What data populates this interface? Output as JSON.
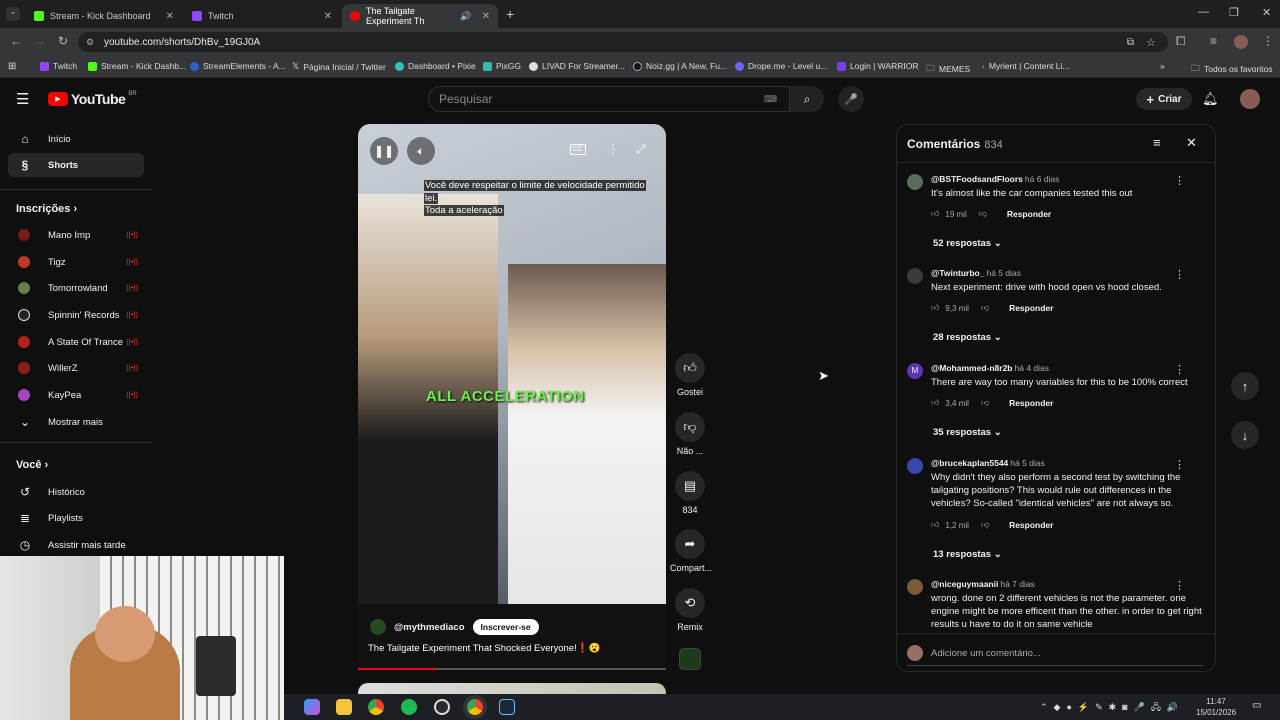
{
  "browser": {
    "tabs": [
      {
        "label": "Stream - Kick Dashboard",
        "color": "#53fc18"
      },
      {
        "label": "Twitch",
        "color": "#9146ff"
      },
      {
        "label": "The Tailgate Experiment Th",
        "color": "#ff0000"
      }
    ],
    "url": "youtube.com/shorts/DhBv_19GJ0A",
    "bookmarks": [
      "Twitch",
      "Stream - Kick Dashb...",
      "StreamElements - A...",
      "Página Inicial / Twitter",
      "Dashboard • Pixie",
      "PixGG",
      "LIVAD For Streamer...",
      "Noiz.gg | A New, Fu...",
      "Drope.me - Level u...",
      "Login | WARRIOR",
      "MEMES",
      "Myrient | Content Li..."
    ],
    "favorites_label": "Todos os favoritos"
  },
  "youtube": {
    "logo": "YouTube",
    "country": "BR",
    "search_placeholder": "Pesquisar",
    "create_label": "Criar"
  },
  "sidebar": {
    "main": [
      {
        "label": "Início",
        "icon": "home-icon"
      },
      {
        "label": "Shorts",
        "icon": "shorts-icon"
      }
    ],
    "subs_heading": "Inscrições",
    "subs": [
      {
        "label": "Mano Imp",
        "color": "#7a1b1b"
      },
      {
        "label": "Tigz",
        "color": "#c0392b"
      },
      {
        "label": "Tomorrowland",
        "color": "#6a7d4c"
      },
      {
        "label": "Spinnin' Records",
        "color": "#222222"
      },
      {
        "label": "A State Of Trance",
        "color": "#b22222"
      },
      {
        "label": "WillerZ",
        "color": "#8b1c1c"
      },
      {
        "label": "KayPea",
        "color": "#a346c2"
      }
    ],
    "show_more": "Mostrar mais",
    "you_heading": "Você",
    "you_items": [
      "Histórico",
      "Playlists",
      "Assistir mais tarde"
    ]
  },
  "video": {
    "caption_line1": "Você deve respeitar o limite de velocidade permitido",
    "caption_line2": "lei.",
    "caption_line3": "Toda a aceleração",
    "overlay_text": "ALL ACCELERATION",
    "channel": "@mythmediaco",
    "subscribe": "Inscrever-se",
    "title": "The Tailgate Experiment That Shocked Everyone!❗😮",
    "progress": 0.25
  },
  "actions": {
    "like": "Gostei",
    "dislike": "Não ...",
    "comments": "834",
    "share": "Compart...",
    "remix": "Remix"
  },
  "comments": {
    "heading": "Comentários",
    "count": "834",
    "reply_label": "Responder",
    "items": [
      {
        "author": "@BSTFoodsandFloors",
        "time": "há 6 dias",
        "text": "It's almost like the car companies tested this out",
        "likes": "19 mil",
        "replies": "52 respostas",
        "color": "#5a6b5c"
      },
      {
        "author": "@Twinturbo_",
        "time": "há 5 dias",
        "text": "Next experiment: drive with hood open vs hood closed.",
        "likes": "9,3 mil",
        "replies": "28 respostas",
        "color": "#3b3b3b"
      },
      {
        "author": "@Mohammed-n8r2b",
        "time": "há 4 dias",
        "text": "There are way too many variables for this to be 100% correct",
        "likes": "3,4 mil",
        "replies": "35 respostas",
        "color": "#5e35b1"
      },
      {
        "author": "@brucekaplan5544",
        "time": "há 5 dias",
        "text": "Why didn't they also perform a second test by switching the tailgating positions? This would rule out differences in the vehicles? So-called \"identical vehicles\" are not always so.",
        "likes": "1,2 mil",
        "replies": "13 respostas",
        "color": "#3949ab"
      },
      {
        "author": "@niceguymaanii",
        "time": "há 7 dias",
        "text": "wrong. done on 2 different vehicles is not the parameter. one engine might be more efficent than the other. in order to get right results u have to do it on same vehicle",
        "likes": "",
        "replies": "",
        "color": "#7a5a3a"
      }
    ],
    "add_placeholder": "Adicione um comentário..."
  },
  "taskbar": {
    "time": "11:47",
    "date": "15/01/2026"
  }
}
